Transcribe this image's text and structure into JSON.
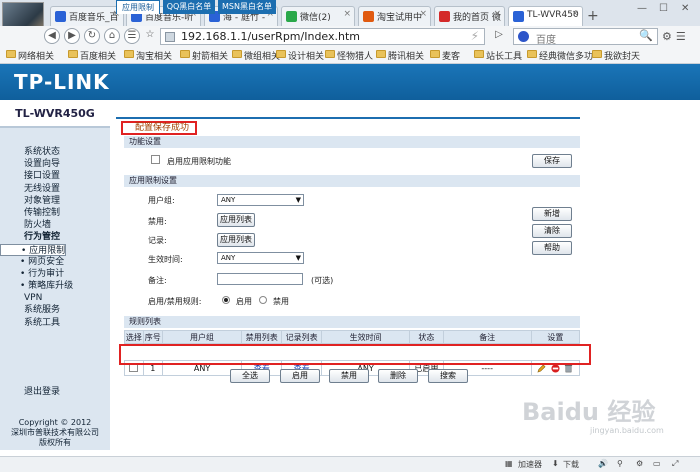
{
  "browser": {
    "tabs": [
      {
        "label": "百度音乐_百"
      },
      {
        "label": "百度音乐-听"
      },
      {
        "label": "海 - 庭竹 -"
      },
      {
        "label": "微信(2)"
      },
      {
        "label": "淘宝试用中"
      },
      {
        "label": "我的首页 微"
      },
      {
        "label": "TL-WVR450"
      }
    ],
    "tab_colors": [
      "#2a62d6",
      "#2a62d6",
      "#2a62d6",
      "#2aa84a",
      "#e05a10",
      "#d42a2a",
      "#2a62d6"
    ],
    "new_tab": "+",
    "url": "192.168.1.1/userRpm/Index.htm",
    "search_placeholder": "百度",
    "bookmarks": [
      "网络相关",
      "百度相关",
      "淘宝相关",
      "射箭相关",
      "微组相关",
      "设计相关",
      "怪物猎人",
      "腾讯相关",
      "麦客",
      "站长工具",
      "经典微信多功",
      "我欲封天"
    ]
  },
  "router": {
    "brand": "TP-LINK",
    "model": "TL-WVR450G",
    "menu": [
      {
        "label": "系统状态",
        "type": "item"
      },
      {
        "label": "设置向导",
        "type": "item"
      },
      {
        "label": "接口设置",
        "type": "item"
      },
      {
        "label": "无线设置",
        "type": "item"
      },
      {
        "label": "对象管理",
        "type": "item"
      },
      {
        "label": "传输控制",
        "type": "item"
      },
      {
        "label": "防火墙",
        "type": "item"
      },
      {
        "label": "行为管控",
        "type": "head"
      },
      {
        "label": "• 应用限制",
        "type": "sub-selected"
      },
      {
        "label": "• 网址过滤",
        "type": "sub"
      },
      {
        "label": "• 网页安全",
        "type": "sub"
      },
      {
        "label": "• 行为审计",
        "type": "sub"
      },
      {
        "label": "• 策略库升级",
        "type": "sub"
      },
      {
        "label": "VPN",
        "type": "item"
      },
      {
        "label": "系统服务",
        "type": "item"
      },
      {
        "label": "系统工具",
        "type": "item"
      }
    ],
    "logout": "退出登录",
    "copyright": [
      "Copyright © 2012",
      "深圳市普联技术有限公司",
      "版权所有"
    ],
    "page_tabs": [
      "应用限制",
      "QQ黑白名单",
      "MSN黑白名单"
    ],
    "status_message": "配置保存成功",
    "function_section": {
      "title": "功能设置",
      "enable_label": "启用应用限制功能",
      "save_button": "保存"
    },
    "app_section": {
      "title": "应用限制设置",
      "user_group_label": "用户组:",
      "user_group_value": "ANY",
      "block_label": "禁用:",
      "block_button": "应用列表",
      "log_label": "记录:",
      "log_button": "应用列表",
      "time_label": "生效时间:",
      "time_value": "ANY",
      "note_label": "备注:",
      "note_value": "",
      "note_hint": "(可选)",
      "rule_label": "启用/禁用规则:",
      "enable_option": "启用",
      "disable_option": "禁用",
      "add_button": "新增",
      "clear_button": "清除",
      "help_button": "帮助"
    },
    "rule_list": {
      "title": "规则列表",
      "headers": [
        "选择",
        "序号",
        "用户组",
        "禁用列表",
        "记录列表",
        "生效时间",
        "状态",
        "备注",
        "设置"
      ],
      "rows": [
        {
          "index": "1",
          "group": "ANY",
          "block": "查看",
          "log": "查看",
          "time": "ANY",
          "status": "已启用",
          "note": "----"
        }
      ],
      "buttons": [
        "全选",
        "启用",
        "禁用",
        "删除",
        "搜索"
      ]
    }
  },
  "statusbar": {
    "accelerator": "加速器",
    "download": "下载"
  },
  "watermark": {
    "text": "Baidu 经验",
    "sub": "jingyan.baidu.com"
  }
}
